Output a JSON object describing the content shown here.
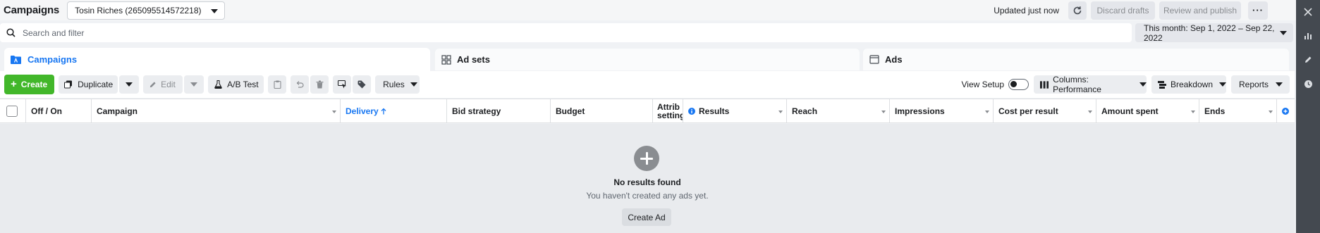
{
  "header": {
    "title": "Campaigns",
    "account": "Tosin Riches (265095514572218)",
    "updated": "Updated just now",
    "discard_label": "Discard drafts",
    "review_label": "Review and publish"
  },
  "search": {
    "placeholder": "Search and filter",
    "date_range": "This month: Sep 1, 2022 – Sep 22, 2022"
  },
  "tabs": [
    {
      "label": "Campaigns"
    },
    {
      "label": "Ad sets"
    },
    {
      "label": "Ads"
    }
  ],
  "toolbar": {
    "create": "Create",
    "duplicate": "Duplicate",
    "edit": "Edit",
    "ab_test": "A/B Test",
    "rules": "Rules",
    "view_setup": "View Setup",
    "columns": "Columns: Performance",
    "breakdown": "Breakdown",
    "reports": "Reports"
  },
  "table": {
    "columns": [
      "Off / On",
      "Campaign",
      "Delivery",
      "Bid strategy",
      "Budget",
      "Attrib setting",
      "Results",
      "Reach",
      "Impressions",
      "Cost per result",
      "Amount spent",
      "Ends"
    ],
    "attribution_line1": "Attrib",
    "attribution_line2": "setting"
  },
  "empty_state": {
    "title": "No results found",
    "subtitle": "You haven't created any ads yet.",
    "button": "Create Ad"
  },
  "colors": {
    "accent": "#1877f2",
    "create_green": "#42b72a",
    "rail": "#444950"
  }
}
